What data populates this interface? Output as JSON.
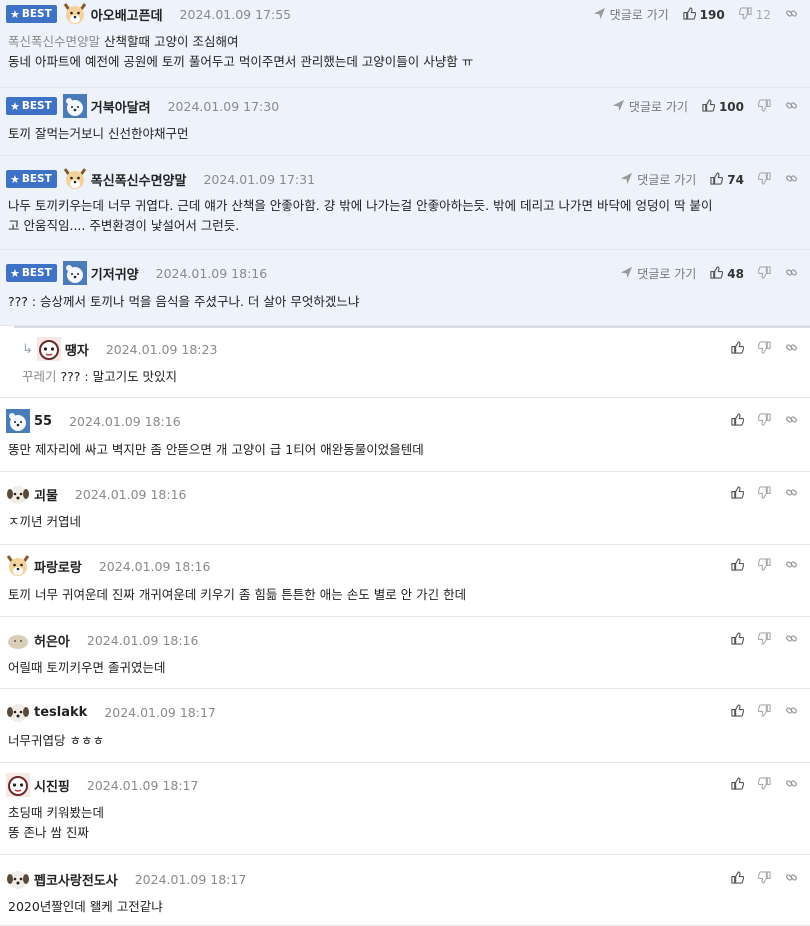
{
  "colors": {
    "badge_bg": "#3e72c6",
    "best_bg": "#eef3fb",
    "date": "#8a8a8a"
  },
  "labels": {
    "best": "BEST",
    "goto": "댓글로 가기",
    "reply_arrow": "↳"
  },
  "comments": [
    {
      "best": true,
      "avatar": "dog-avatar-icon",
      "nick": "아오배고픈데",
      "date": "2024.01.09 17:55",
      "likes": "190",
      "dislikes": "12",
      "reply_to": "폭신폭신수면양말",
      "text": "산책할때 고양이 조심해여\n동네 아파트에 예전에 공원에 토끼 풀어두고 먹이주면서 관리했는데 고양이들이 사냥함 ㅠ"
    },
    {
      "best": true,
      "avatar": "polarbear-avatar-icon",
      "nick": "거북아달려",
      "date": "2024.01.09 17:30",
      "likes": "100",
      "text": "토끼 잘먹는거보니 신선한야채구먼"
    },
    {
      "best": true,
      "avatar": "dog-avatar-icon",
      "nick": "폭신폭신수면양말",
      "date": "2024.01.09 17:31",
      "likes": "74",
      "text": "나두 토끼키우는데 너무 귀엽다. 근데 얘가 산책을 안좋아함. 걍 밖에 나가는걸 안좋아하는듯. 밖에 데리고 나가면 바닥에 엉덩이 딱 붙이\n고 안움직임.... 주변환경이 낯설어서 그런듯."
    },
    {
      "best": true,
      "avatar": "polarbear-avatar-icon",
      "nick": "기저귀양",
      "date": "2024.01.09 18:16",
      "likes": "48",
      "text": "??? : 승상께서 토끼나 먹을 음식을 주셨구나. 더 살아 무엇하겠느냐"
    },
    {
      "reply": true,
      "avatar": "character-avatar-icon",
      "nick": "땡자",
      "date": "2024.01.09 18:23",
      "reply_to": "꾸레기",
      "text": "??? : 말고기도 맛있지"
    },
    {
      "avatar": "polarbear-avatar-icon",
      "nick": "55",
      "date": "2024.01.09 18:16",
      "text": "똥만 제자리에 싸고 벽지만 좀 안뜯으면 개 고양이 급 1티어 애완동물이었을텐데"
    },
    {
      "avatar": "puppy-avatar-icon",
      "nick": "괴물",
      "date": "2024.01.09 18:16",
      "text": "ㅈ끼년 커엽네"
    },
    {
      "avatar": "dog-avatar-icon",
      "nick": "파랑로랑",
      "date": "2024.01.09 18:16",
      "text": "토끼 너무 귀여운데 진짜 개귀여운데 키우기 좀 힘듦 튼튼한 애는 손도 별로 안 가긴 한데"
    },
    {
      "avatar": "blob-avatar-icon",
      "nick": "허은아",
      "date": "2024.01.09 18:16",
      "text": "어릴때 토끼키우면 졸귀였는데"
    },
    {
      "avatar": "puppy-avatar-icon",
      "nick": "teslakk",
      "date": "2024.01.09 18:17",
      "text": "너무귀엽당 ㅎㅎㅎ"
    },
    {
      "avatar": "character-avatar-icon",
      "nick": "시진핑",
      "date": "2024.01.09 18:17",
      "text": "초딩때 키워봤는데\n똥 존나 쌈 진짜"
    },
    {
      "avatar": "puppy-avatar-icon",
      "nick": "펩코사랑전도사",
      "date": "2024.01.09 18:17",
      "text": "2020년짤인데 왤케 고전같냐"
    }
  ]
}
